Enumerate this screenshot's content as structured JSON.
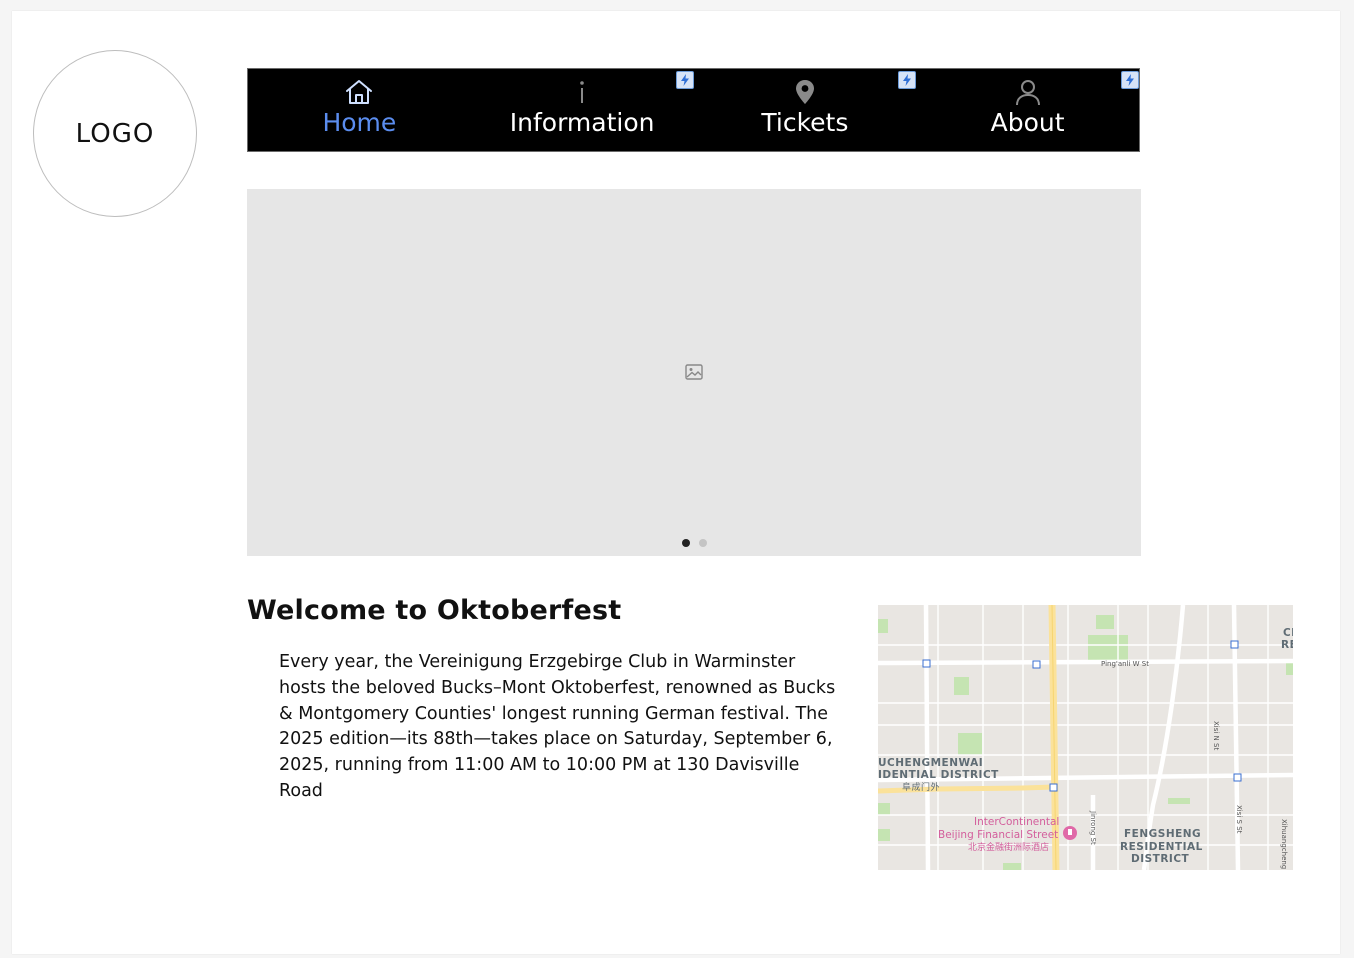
{
  "logo": {
    "text": "LOGO"
  },
  "nav": {
    "items": [
      {
        "label": "Home",
        "icon": "home-icon",
        "active": true
      },
      {
        "label": "Information",
        "icon": "info-icon",
        "active": false
      },
      {
        "label": "Tickets",
        "icon": "location-pin-icon",
        "active": false
      },
      {
        "label": "About",
        "icon": "user-icon",
        "active": false
      }
    ],
    "accent_color": "#5b8def"
  },
  "carousel": {
    "image_icon": "image-icon",
    "slides": 2,
    "active_slide": 1
  },
  "welcome": {
    "title": "Welcome to Oktoberfest",
    "body": "Every year, the Vereinigung Erzgebirge Club in Warminster hosts the beloved Bucks–Mont Oktoberfest, renowned as Bucks & Montgomery Counties' longest running German festival. The 2025 edition—its 88th—takes place on Saturday, September 6, 2025, running from 11:00 AM to 10:00 PM at 130 Davisville Road"
  },
  "map": {
    "labels": {
      "district_west_1": "UCHENGMENWAI",
      "district_west_2": "IDENTIAL DISTRICT",
      "district_west_cn": "阜成门外",
      "poi_1": "InterContinental",
      "poi_2": "Beijing Financial Street",
      "poi_cn": "北京金融街洲际酒店",
      "district_south_1": "FENGSHENG",
      "district_south_2": "RESIDENTIAL",
      "district_south_3": "DISTRICT",
      "street_1": "Ping'anli W St",
      "street_2": "Xisi N St",
      "street_3": "Xisi S St",
      "street_4": "Jinrong St",
      "street_5": "Xihuangcheng",
      "edge_1": "Cl",
      "edge_2": "RE"
    }
  }
}
